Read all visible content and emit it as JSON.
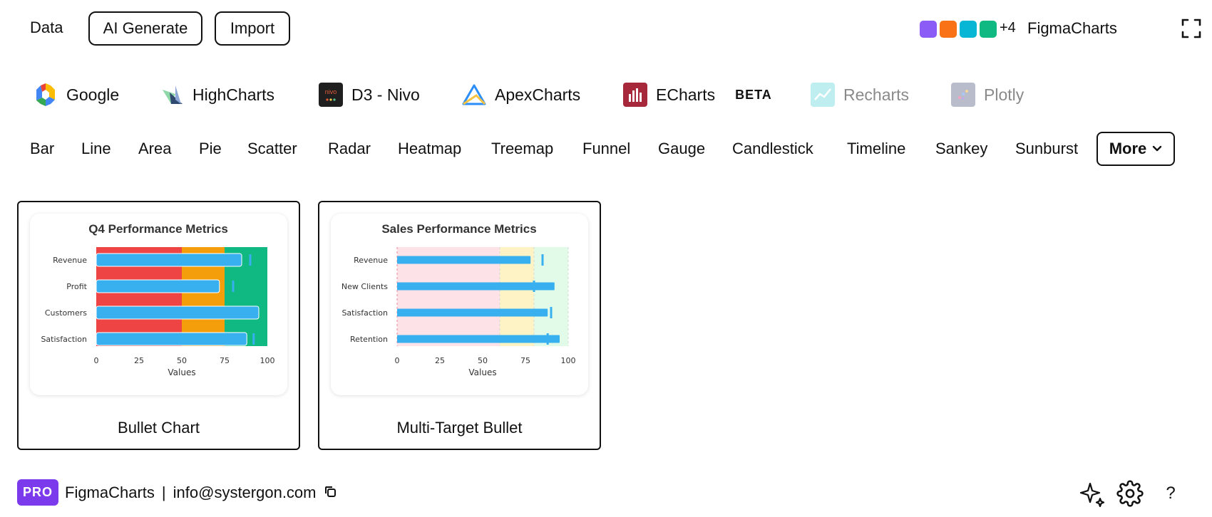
{
  "topbar": {
    "data_label": "Data",
    "ai_generate_label": "AI Generate",
    "import_label": "Import",
    "swatch_colors": [
      "#8b5cf6",
      "#f97316",
      "#06b6d4",
      "#10b981"
    ],
    "swatch_more": "+4",
    "brand": "FigmaCharts",
    "fullscreen_icon": "expand-icon"
  },
  "libraries": [
    {
      "label": "Google",
      "icon": "google-logo-icon",
      "disabled": false
    },
    {
      "label": "HighCharts",
      "icon": "highcharts-logo-icon",
      "disabled": false
    },
    {
      "label": "D3 - Nivo",
      "icon": "nivo-logo-icon",
      "icon_text": "nivo",
      "disabled": false
    },
    {
      "label": "ApexCharts",
      "icon": "apexcharts-logo-icon",
      "disabled": false
    },
    {
      "label": "ECharts",
      "icon": "echarts-logo-icon",
      "badge": "BETA",
      "disabled": false
    },
    {
      "label": "Recharts",
      "icon": "recharts-logo-icon",
      "disabled": true
    },
    {
      "label": "Plotly",
      "icon": "plotly-logo-icon",
      "disabled": true
    }
  ],
  "chart_types": [
    "Bar",
    "Line",
    "Area",
    "Pie",
    "Scatter",
    "Radar",
    "Heatmap",
    "Treemap",
    "Funnel",
    "Gauge",
    "Candlestick",
    "Timeline",
    "Sankey",
    "Sunburst"
  ],
  "more_label": "More",
  "colors": {
    "band_poor": "#ef4444",
    "band_avg": "#f59e0b",
    "band_good": "#10b981",
    "bar": "#38b0f0",
    "band_poor_light": "#fde2e7",
    "band_avg_light": "#fdf3c4",
    "band_good_light": "#e2fbe8",
    "pro": "#7c3aed"
  },
  "cards": [
    {
      "name": "Bullet Chart",
      "chart_data": {
        "type": "bar",
        "title": "Q4 Performance Metrics",
        "categories": [
          "Revenue",
          "Profit",
          "Customers",
          "Satisfaction"
        ],
        "values": [
          85,
          72,
          95,
          88
        ],
        "targets": [
          90,
          80,
          85,
          92
        ],
        "ranges": [
          50,
          75,
          100
        ],
        "xlabel": "Values",
        "ylabel": "",
        "xlim": [
          0,
          100
        ],
        "xticks": [
          0,
          25,
          50,
          75,
          100
        ]
      }
    },
    {
      "name": "Multi-Target Bullet",
      "chart_data": {
        "type": "bar",
        "title": "Sales Performance Metrics",
        "categories": [
          "Revenue",
          "New Clients",
          "Satisfaction",
          "Retention"
        ],
        "values": [
          78,
          92,
          88,
          95
        ],
        "targets": [
          85,
          80,
          90,
          88
        ],
        "ranges": [
          60,
          80,
          100
        ],
        "xlabel": "Values",
        "ylabel": "",
        "xlim": [
          0,
          100
        ],
        "xticks": [
          0,
          25,
          50,
          75,
          100
        ]
      }
    }
  ],
  "footer": {
    "pro_label": "PRO",
    "brand": "FigmaCharts",
    "separator": "|",
    "email": "info@systergon.com",
    "copy_icon": "copy-icon",
    "sparkle_icon": "sparkle-icon",
    "settings_icon": "gear-icon",
    "help_label": "?"
  }
}
